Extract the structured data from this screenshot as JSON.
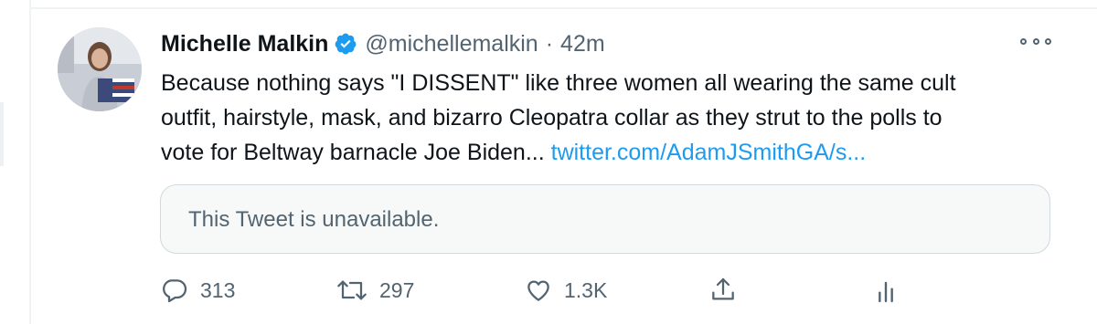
{
  "tweet": {
    "author_name": "Michelle Malkin",
    "verified": true,
    "handle": "@michellemalkin",
    "separator": "·",
    "time": "42m",
    "text_lines": [
      "Because nothing says \"I DISSENT\" like three women all wearing the same cult",
      "outfit, hairstyle, mask, and bizarro Cleopatra collar as they strut to the polls to",
      "vote for Beltway barnacle Joe Biden... "
    ],
    "link_text": "twitter.com/AdamJSmithGA/s...",
    "quoted_tweet": "This Tweet is unavailable.",
    "replies": "313",
    "retweets": "297",
    "likes": "1.3K"
  },
  "icons": {
    "verified": "verified-badge-icon",
    "more": "more-options-icon",
    "reply": "reply-icon",
    "retweet": "retweet-icon",
    "like": "heart-icon",
    "share": "share-icon",
    "analytics": "analytics-icon"
  },
  "colors": {
    "link": "#1d9bf0",
    "secondary_text": "#536471",
    "primary_text": "#0f1419",
    "border": "#cfd9de"
  }
}
